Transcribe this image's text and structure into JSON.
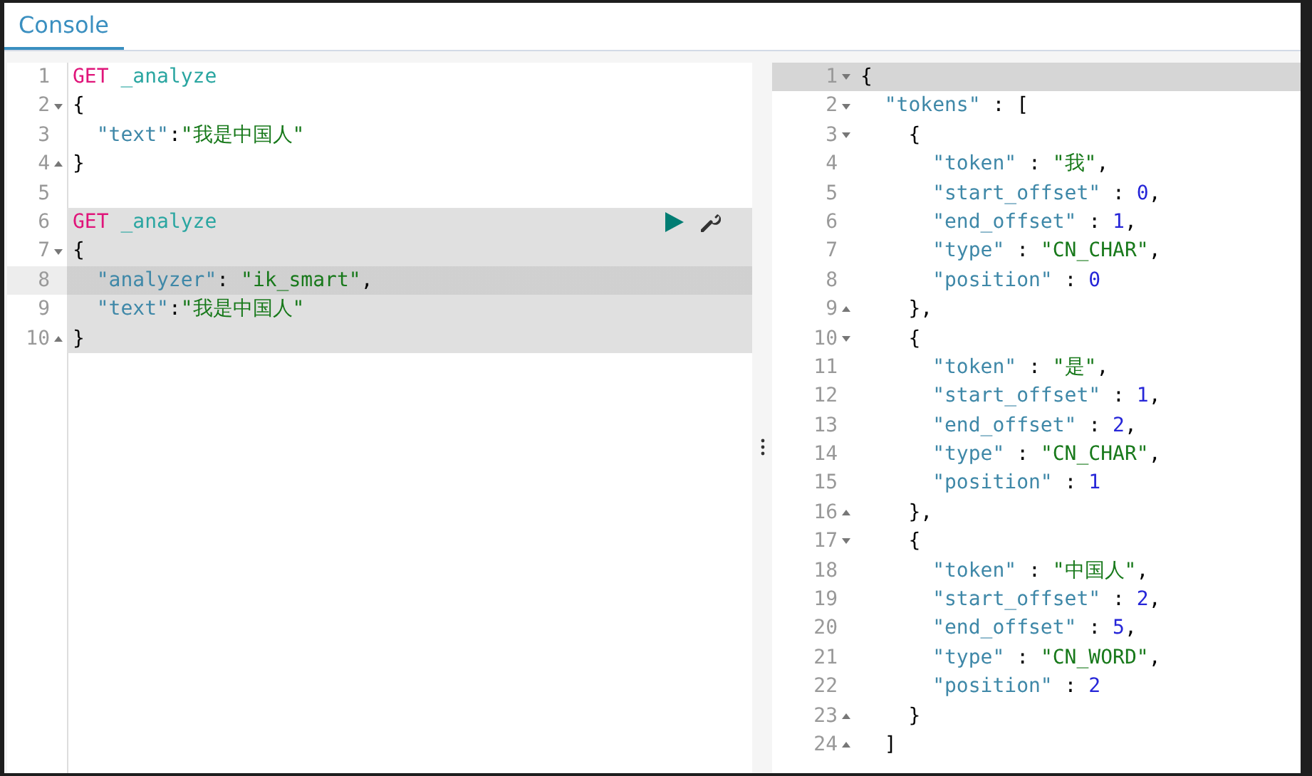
{
  "tabs": [
    {
      "label": "Console",
      "selected": true
    }
  ],
  "request_editor": {
    "lines": [
      {
        "number": "1",
        "fold_start": false,
        "fold_end": false,
        "highlighted": false,
        "active": false,
        "actions": false,
        "tokens": [
          {
            "kind": "method",
            "text": "GET"
          },
          {
            "kind": "path",
            "text": " _analyze"
          }
        ]
      },
      {
        "number": "2",
        "fold_start": true,
        "fold_end": false,
        "highlighted": false,
        "active": false,
        "actions": false,
        "tokens": [
          {
            "kind": "punct",
            "text": "{"
          }
        ]
      },
      {
        "number": "3",
        "fold_start": false,
        "fold_end": false,
        "highlighted": false,
        "active": false,
        "actions": false,
        "tokens": [
          {
            "kind": "key",
            "text": "  \"text\""
          },
          {
            "kind": "punct",
            "text": ":"
          },
          {
            "kind": "string",
            "text": "\"我是中国人\""
          }
        ]
      },
      {
        "number": "4",
        "fold_start": false,
        "fold_end": true,
        "highlighted": false,
        "active": false,
        "actions": false,
        "tokens": [
          {
            "kind": "punct",
            "text": "}"
          }
        ]
      },
      {
        "number": "5",
        "fold_start": false,
        "fold_end": false,
        "highlighted": false,
        "active": false,
        "actions": false
      },
      {
        "number": "6",
        "fold_start": false,
        "fold_end": false,
        "highlighted": true,
        "active": false,
        "actions": true,
        "tokens": [
          {
            "kind": "method",
            "text": "GET"
          },
          {
            "kind": "path",
            "text": " _analyze"
          }
        ]
      },
      {
        "number": "7",
        "fold_start": true,
        "fold_end": false,
        "highlighted": true,
        "active": false,
        "actions": false,
        "tokens": [
          {
            "kind": "punct",
            "text": "{"
          }
        ]
      },
      {
        "number": "8",
        "fold_start": false,
        "fold_end": false,
        "highlighted": true,
        "active": true,
        "actions": false,
        "tokens": [
          {
            "kind": "key",
            "text": "  \"analyzer\""
          },
          {
            "kind": "punct",
            "text": ": "
          },
          {
            "kind": "string",
            "text": "\"ik_smart\""
          },
          {
            "kind": "punct",
            "text": ","
          }
        ]
      },
      {
        "number": "9",
        "fold_start": false,
        "fold_end": false,
        "highlighted": true,
        "active": false,
        "actions": false,
        "tokens": [
          {
            "kind": "key",
            "text": "  \"text\""
          },
          {
            "kind": "punct",
            "text": ":"
          },
          {
            "kind": "string",
            "text": "\"我是中国人\""
          }
        ]
      },
      {
        "number": "10",
        "fold_start": false,
        "fold_end": true,
        "highlighted": true,
        "active": false,
        "actions": false,
        "tokens": [
          {
            "kind": "punct",
            "text": "}"
          }
        ]
      }
    ]
  },
  "response_editor": {
    "lines": [
      {
        "number": "1",
        "fold_start": true,
        "fold_end": false,
        "active": true,
        "tokens": [
          {
            "kind": "punct",
            "text": "{"
          }
        ]
      },
      {
        "number": "2",
        "fold_start": true,
        "fold_end": false,
        "active": false,
        "tokens": [
          {
            "kind": "key",
            "text": "  \"tokens\""
          },
          {
            "kind": "punct",
            "text": " : ["
          }
        ]
      },
      {
        "number": "3",
        "fold_start": true,
        "fold_end": false,
        "active": false,
        "tokens": [
          {
            "kind": "punct",
            "text": "    {"
          }
        ]
      },
      {
        "number": "4",
        "fold_start": false,
        "fold_end": false,
        "active": false,
        "tokens": [
          {
            "kind": "key",
            "text": "      \"token\""
          },
          {
            "kind": "punct",
            "text": " : "
          },
          {
            "kind": "string",
            "text": "\"我\""
          },
          {
            "kind": "punct",
            "text": ","
          }
        ]
      },
      {
        "number": "5",
        "fold_start": false,
        "fold_end": false,
        "active": false,
        "tokens": [
          {
            "kind": "key",
            "text": "      \"start_offset\""
          },
          {
            "kind": "punct",
            "text": " : "
          },
          {
            "kind": "number",
            "text": "0"
          },
          {
            "kind": "punct",
            "text": ","
          }
        ]
      },
      {
        "number": "6",
        "fold_start": false,
        "fold_end": false,
        "active": false,
        "tokens": [
          {
            "kind": "key",
            "text": "      \"end_offset\""
          },
          {
            "kind": "punct",
            "text": " : "
          },
          {
            "kind": "number",
            "text": "1"
          },
          {
            "kind": "punct",
            "text": ","
          }
        ]
      },
      {
        "number": "7",
        "fold_start": false,
        "fold_end": false,
        "active": false,
        "tokens": [
          {
            "kind": "key",
            "text": "      \"type\""
          },
          {
            "kind": "punct",
            "text": " : "
          },
          {
            "kind": "string",
            "text": "\"CN_CHAR\""
          },
          {
            "kind": "punct",
            "text": ","
          }
        ]
      },
      {
        "number": "8",
        "fold_start": false,
        "fold_end": false,
        "active": false,
        "tokens": [
          {
            "kind": "key",
            "text": "      \"position\""
          },
          {
            "kind": "punct",
            "text": " : "
          },
          {
            "kind": "number",
            "text": "0"
          }
        ]
      },
      {
        "number": "9",
        "fold_start": false,
        "fold_end": true,
        "active": false,
        "tokens": [
          {
            "kind": "punct",
            "text": "    },"
          }
        ]
      },
      {
        "number": "10",
        "fold_start": true,
        "fold_end": false,
        "active": false,
        "tokens": [
          {
            "kind": "punct",
            "text": "    {"
          }
        ]
      },
      {
        "number": "11",
        "fold_start": false,
        "fold_end": false,
        "active": false,
        "tokens": [
          {
            "kind": "key",
            "text": "      \"token\""
          },
          {
            "kind": "punct",
            "text": " : "
          },
          {
            "kind": "string",
            "text": "\"是\""
          },
          {
            "kind": "punct",
            "text": ","
          }
        ]
      },
      {
        "number": "12",
        "fold_start": false,
        "fold_end": false,
        "active": false,
        "tokens": [
          {
            "kind": "key",
            "text": "      \"start_offset\""
          },
          {
            "kind": "punct",
            "text": " : "
          },
          {
            "kind": "number",
            "text": "1"
          },
          {
            "kind": "punct",
            "text": ","
          }
        ]
      },
      {
        "number": "13",
        "fold_start": false,
        "fold_end": false,
        "active": false,
        "tokens": [
          {
            "kind": "key",
            "text": "      \"end_offset\""
          },
          {
            "kind": "punct",
            "text": " : "
          },
          {
            "kind": "number",
            "text": "2"
          },
          {
            "kind": "punct",
            "text": ","
          }
        ]
      },
      {
        "number": "14",
        "fold_start": false,
        "fold_end": false,
        "active": false,
        "tokens": [
          {
            "kind": "key",
            "text": "      \"type\""
          },
          {
            "kind": "punct",
            "text": " : "
          },
          {
            "kind": "string",
            "text": "\"CN_CHAR\""
          },
          {
            "kind": "punct",
            "text": ","
          }
        ]
      },
      {
        "number": "15",
        "fold_start": false,
        "fold_end": false,
        "active": false,
        "tokens": [
          {
            "kind": "key",
            "text": "      \"position\""
          },
          {
            "kind": "punct",
            "text": " : "
          },
          {
            "kind": "number",
            "text": "1"
          }
        ]
      },
      {
        "number": "16",
        "fold_start": false,
        "fold_end": true,
        "active": false,
        "tokens": [
          {
            "kind": "punct",
            "text": "    },"
          }
        ]
      },
      {
        "number": "17",
        "fold_start": true,
        "fold_end": false,
        "active": false,
        "tokens": [
          {
            "kind": "punct",
            "text": "    {"
          }
        ]
      },
      {
        "number": "18",
        "fold_start": false,
        "fold_end": false,
        "active": false,
        "tokens": [
          {
            "kind": "key",
            "text": "      \"token\""
          },
          {
            "kind": "punct",
            "text": " : "
          },
          {
            "kind": "string",
            "text": "\"中国人\""
          },
          {
            "kind": "punct",
            "text": ","
          }
        ]
      },
      {
        "number": "19",
        "fold_start": false,
        "fold_end": false,
        "active": false,
        "tokens": [
          {
            "kind": "key",
            "text": "      \"start_offset\""
          },
          {
            "kind": "punct",
            "text": " : "
          },
          {
            "kind": "number",
            "text": "2"
          },
          {
            "kind": "punct",
            "text": ","
          }
        ]
      },
      {
        "number": "20",
        "fold_start": false,
        "fold_end": false,
        "active": false,
        "tokens": [
          {
            "kind": "key",
            "text": "      \"end_offset\""
          },
          {
            "kind": "punct",
            "text": " : "
          },
          {
            "kind": "number",
            "text": "5"
          },
          {
            "kind": "punct",
            "text": ","
          }
        ]
      },
      {
        "number": "21",
        "fold_start": false,
        "fold_end": false,
        "active": false,
        "tokens": [
          {
            "kind": "key",
            "text": "      \"type\""
          },
          {
            "kind": "punct",
            "text": " : "
          },
          {
            "kind": "string",
            "text": "\"CN_WORD\""
          },
          {
            "kind": "punct",
            "text": ","
          }
        ]
      },
      {
        "number": "22",
        "fold_start": false,
        "fold_end": false,
        "active": false,
        "tokens": [
          {
            "kind": "key",
            "text": "      \"position\""
          },
          {
            "kind": "punct",
            "text": " : "
          },
          {
            "kind": "number",
            "text": "2"
          }
        ]
      },
      {
        "number": "23",
        "fold_start": false,
        "fold_end": true,
        "active": false,
        "tokens": [
          {
            "kind": "punct",
            "text": "    }"
          }
        ]
      },
      {
        "number": "24",
        "fold_start": false,
        "fold_end": true,
        "active": false,
        "tokens": [
          {
            "kind": "punct",
            "text": "  ]"
          }
        ]
      }
    ]
  }
}
